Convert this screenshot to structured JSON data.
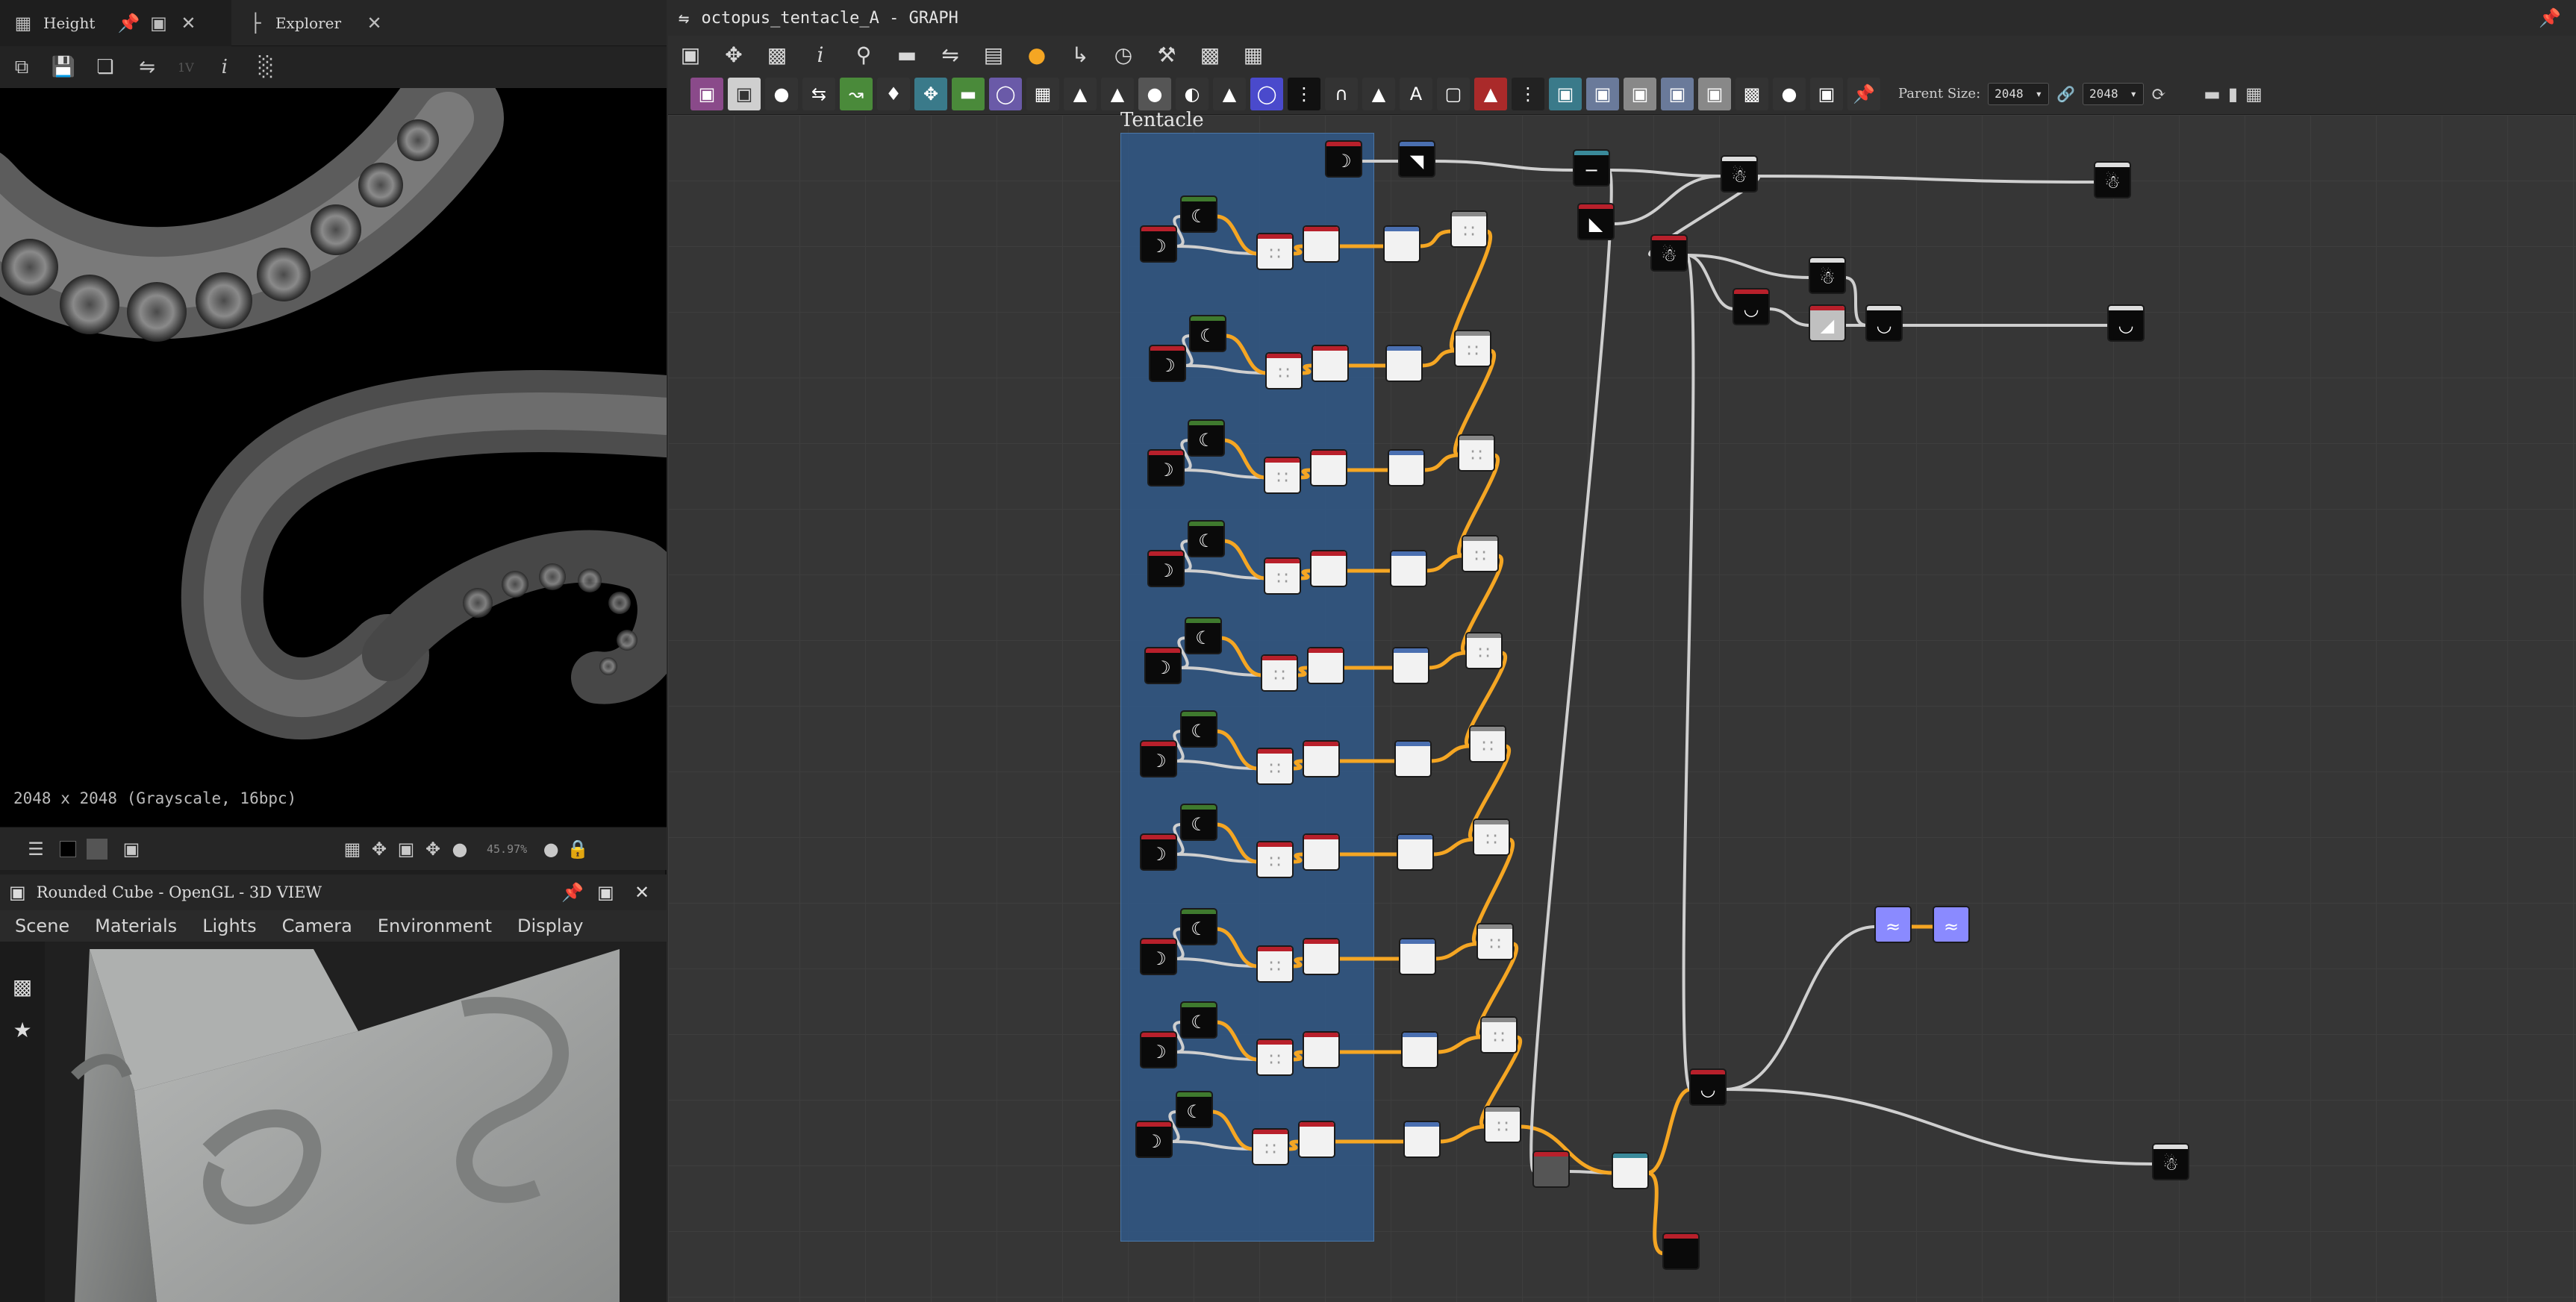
{
  "left_tabs": [
    {
      "label": "Height",
      "icon": "grid-icon"
    },
    {
      "label": "Explorer",
      "icon": "tree-icon"
    }
  ],
  "viewer2d": {
    "toolbar_disabled_label": "1V",
    "info": "2048 x 2048 (Grayscale, 16bpc)",
    "zoom": "45.97%"
  },
  "viewer3d": {
    "title": "Rounded Cube - OpenGL - 3D VIEW",
    "menu": [
      "Scene",
      "Materials",
      "Lights",
      "Camera",
      "Environment",
      "Display"
    ]
  },
  "graph": {
    "title": "octopus_tentacle_A - GRAPH",
    "frame_title": "Tentacle",
    "parent_size_label": "Parent Size:",
    "width_value": "2048",
    "height_value": "2048"
  },
  "colors": {
    "frame": "#305887",
    "wire_orange": "#f5a623",
    "wire_gray": "#cfcfcf",
    "node_red": "#b8202b",
    "node_green": "#3f7a2e",
    "node_blue": "#4a6fb0"
  }
}
